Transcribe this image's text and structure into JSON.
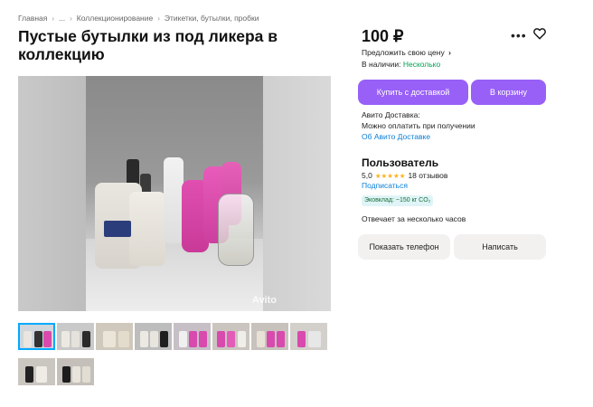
{
  "breadcrumb": [
    "Главная",
    "...",
    "Коллекционирование",
    "Этикетки, бутылки, пробки"
  ],
  "title": "Пустые бутылки из под ликера в коллекцию",
  "price": "100 ₽",
  "offer_price": "Предложить свою цену",
  "availability": {
    "label": "В наличии:",
    "value": "Несколько"
  },
  "buttons": {
    "buy_delivery": "Купить с доставкой",
    "to_cart": "В корзину",
    "show_phone": "Показать телефон",
    "write": "Написать"
  },
  "delivery": {
    "title": "Авито Доставка:",
    "pay": "Можно оплатить при получении",
    "link": "Об Авито Доставке"
  },
  "seller": {
    "name": "Пользователь",
    "rating": "5,0",
    "stars": "★★★★★",
    "reviews": "18 отзывов",
    "subscribe": "Подписаться",
    "eco_badge": "Эковклад: ~150 кг CO₂",
    "response_time": "Отвечает за несколько часов"
  },
  "gallery": {
    "watermark": "Avito",
    "thumbnail_count": 10,
    "active_thumbnail": 1
  },
  "colors": {
    "accent": "#9860f7",
    "link": "#0a7fd8",
    "available": "#02a354",
    "star": "#ffb021"
  },
  "icons": [
    "more-icon",
    "heart-icon",
    "chevron-right-icon"
  ]
}
